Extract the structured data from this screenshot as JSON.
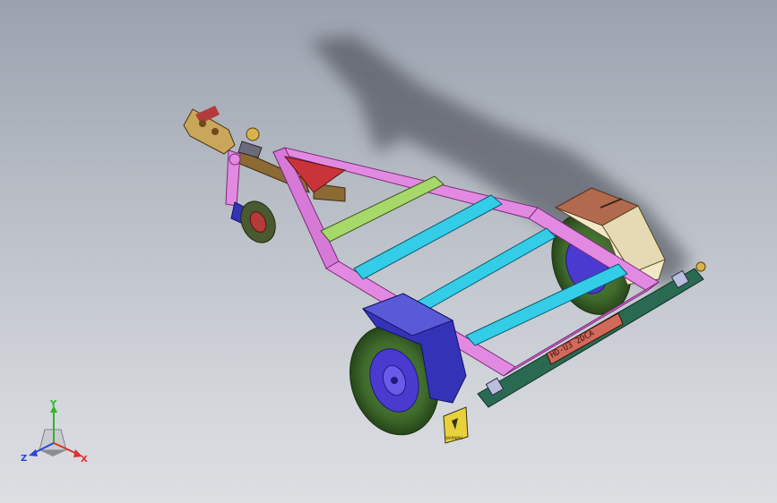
{
  "viewport": {
    "background_top": "#9ba2ae",
    "background_bottom": "#dcdee2"
  },
  "model": {
    "colors": {
      "frame": "#e28ae2",
      "front_plate": "#c8343a",
      "crossbar_green": "#a6d86a",
      "crossbars_cyan": "#33cde8",
      "fender": "#3433b8",
      "tire": "#3f6a2c",
      "rear_bar": "#2a6a52",
      "box": "#f2e8c8",
      "box_lid": "#b26a4e",
      "hitch": "#8c6a34"
    },
    "plate_text": "HD-U3 2DCA",
    "warning_label": "WARNING"
  },
  "triad": {
    "x_label": "X",
    "y_label": "Y",
    "z_label": "Z",
    "x_color": "#e0302a",
    "y_color": "#2eb52e",
    "z_color": "#2a46d8"
  }
}
